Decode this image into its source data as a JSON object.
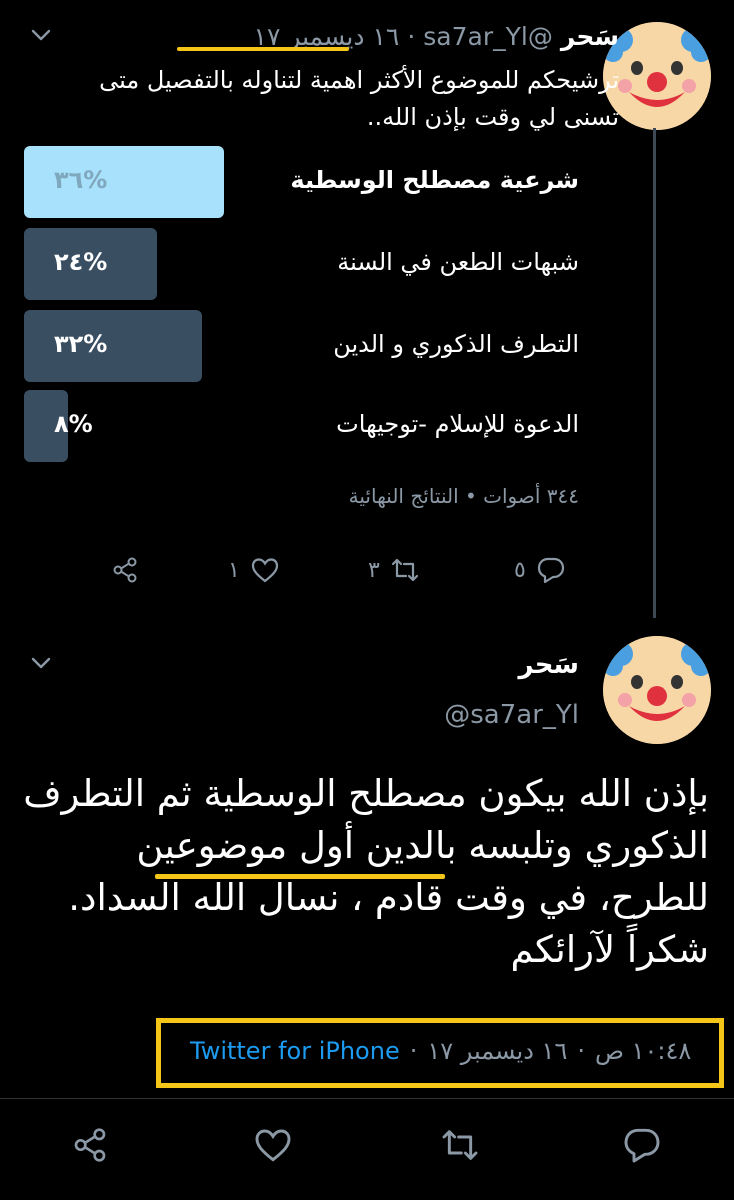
{
  "tweet1": {
    "display_name": "سَحر",
    "handle": "@sa7ar_Yl",
    "date": "١٦ ديسمبر ١٧",
    "text": "ترشيحكم للموضوع الأكثر اهمية لتناوله بالتفصيل متى تسنى لي وقت بإذن الله..",
    "poll": {
      "options": [
        {
          "label": "شرعية مصطلح الوسطية",
          "percent_text": "%٣٦",
          "percent": 36,
          "winner": true
        },
        {
          "label": "شبهات الطعن في السنة",
          "percent_text": "%٢٤",
          "percent": 24,
          "winner": false
        },
        {
          "label": "التطرف الذكوري و الدين",
          "percent_text": "%٣٢",
          "percent": 32,
          "winner": false
        },
        {
          "label": "الدعوة للإسلام -توجيهات",
          "percent_text": "%٨",
          "percent": 8,
          "winner": false
        }
      ],
      "meta": "٣٤٤ أصوات • النتائج النهائية"
    },
    "actions": {
      "reply_count": "٥",
      "retweet_count": "٣",
      "like_count": "١"
    }
  },
  "tweet2": {
    "display_name": "سَحر",
    "handle": "@sa7ar_Yl",
    "text": "بإذن الله بيكون مصطلح الوسطية ثم التطرف الذكوري وتلبسه بالدين أول موضوعين للطرح، في وقت قادم ، نسال الله السداد. شكراً لآرائكم",
    "time": "١٠:٤٨ ص",
    "date": "١٦ ديسمبر ١٧",
    "source": "Twitter for iPhone"
  },
  "colors": {
    "background": "#000000",
    "winner_bar": "#a8e1fb",
    "other_bar": "#3a4e62",
    "highlight": "#f5c518",
    "link": "#1d9bf0",
    "muted": "#8b98a5"
  }
}
